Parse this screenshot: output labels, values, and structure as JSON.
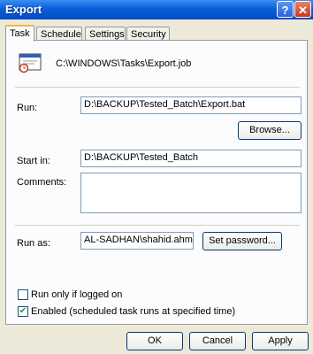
{
  "window": {
    "title": "Export",
    "help_glyph": "?",
    "close_glyph": "✕"
  },
  "tabs": [
    {
      "label": "Task",
      "active": true
    },
    {
      "label": "Schedule",
      "active": false
    },
    {
      "label": "Settings",
      "active": false
    },
    {
      "label": "Security",
      "active": false
    }
  ],
  "task": {
    "job_path": "C:\\WINDOWS\\Tasks\\Export.job",
    "run_label": "Run:",
    "run_value": "D:\\BACKUP\\Tested_Batch\\Export.bat",
    "browse_label": "Browse...",
    "start_in_label": "Start in:",
    "start_in_value": "D:\\BACKUP\\Tested_Batch",
    "comments_label": "Comments:",
    "comments_value": "",
    "run_as_label": "Run as:",
    "run_as_value": "AL-SADHAN\\shahid.ahmed",
    "set_password_label": "Set password...",
    "run_only_logged_on_label": "Run only if logged on",
    "run_only_logged_on_checked": false,
    "enabled_label": "Enabled (scheduled task runs at specified time)",
    "enabled_checked": true
  },
  "footer": {
    "ok_label": "OK",
    "cancel_label": "Cancel",
    "apply_label": "Apply"
  }
}
